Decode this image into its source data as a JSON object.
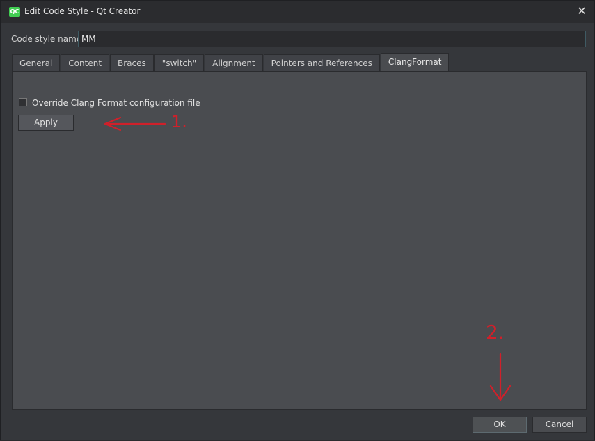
{
  "window": {
    "title": "Edit Code Style - Qt Creator",
    "app_icon_text": "QC"
  },
  "code_style": {
    "label": "Code style name:",
    "value": "MM"
  },
  "tabs": [
    {
      "label": "General",
      "active": false
    },
    {
      "label": "Content",
      "active": false
    },
    {
      "label": "Braces",
      "active": false
    },
    {
      "label": "\"switch\"",
      "active": false
    },
    {
      "label": "Alignment",
      "active": false
    },
    {
      "label": "Pointers and References",
      "active": false
    },
    {
      "label": "ClangFormat",
      "active": true
    }
  ],
  "clang_format": {
    "override_label": "Override Clang Format configuration file",
    "override_checked": false,
    "apply_label": "Apply"
  },
  "annotations": {
    "mark_1": "1.",
    "mark_2": "2.",
    "color": "#d0202a"
  },
  "buttons": {
    "ok_label": "OK",
    "cancel_label": "Cancel"
  }
}
